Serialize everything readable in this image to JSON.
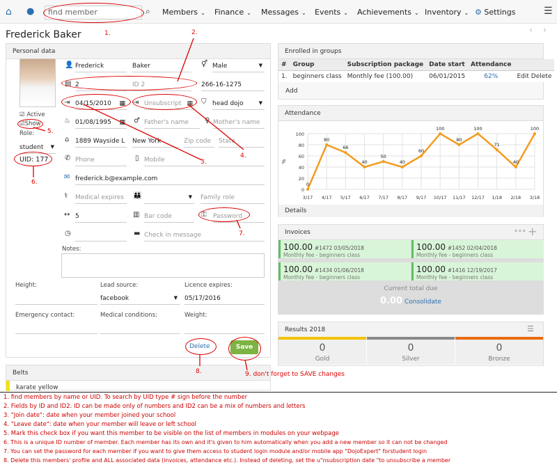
{
  "nav": {
    "search_placeholder": "find member",
    "items": [
      "Members",
      "Finance",
      "Messages",
      "Events",
      "Achievements",
      "Inventory"
    ],
    "settings": "Settings"
  },
  "member": {
    "name": "Frederick Baker",
    "first_name": "Frederick",
    "last_name": "Baker",
    "gender": "Male",
    "id": "2",
    "id2_placeholder": "ID 2",
    "ssn": "266-16-1275",
    "join_date": "04/15/2010",
    "leave_placeholder": "Unsubscript",
    "rank": "head dojo",
    "birth_date": "01/08/1995",
    "fathers_name_ph": "Father's name",
    "mothers_name_ph": "Mother's name",
    "address": "1889 Wayside L",
    "city": "New York",
    "zip_ph": "Zip code",
    "state_ph": "State",
    "phone_ph": "Phone",
    "mobile_ph": "Mobile",
    "email": "frederick.b@example.com",
    "medical_ph": "Medical expires",
    "family_role_ph": "Family role",
    "number": "5",
    "barcode_ph": "Bar code",
    "password_ph": "Password",
    "checkin_ph": "Check in message",
    "active_label": "Active",
    "show_label": "Show",
    "role_label": "Role:",
    "role": "student",
    "uid": "UID: 177",
    "notes_label": "Notes:",
    "height_label": "Height:",
    "lead_label": "Lead source:",
    "lead_value": "facebook",
    "licence_label": "Licence expires:",
    "licence_value": "05/17/2016",
    "emergency_label": "Emergency contact:",
    "medcond_label": "Medical conditions:",
    "weight_label": "Weight:",
    "delete_label": "Delete",
    "save_label": "Save"
  },
  "personal_title": "Personal data",
  "belts": {
    "title": "Belts",
    "item": "karate yellow"
  },
  "groups": {
    "title": "Enrolled in groups",
    "headers": [
      "#",
      "Group",
      "Subscription package",
      "Date start",
      "Attendance",
      ""
    ],
    "rows": [
      [
        "1.",
        "beginners class",
        "Monthly fee (100.00)",
        "06/01/2015",
        "62%",
        "Edit Delete"
      ]
    ],
    "add": "Add"
  },
  "attendance": {
    "title": "Attendance",
    "details": "Details"
  },
  "chart_data": {
    "type": "line",
    "title": "",
    "xlabel": "",
    "ylabel": "%",
    "ylim": [
      0,
      100
    ],
    "yticks": [
      0,
      20,
      40,
      60,
      80,
      100
    ],
    "categories": [
      "3/17",
      "4/17",
      "5/17",
      "6/17",
      "7/17",
      "8/17",
      "9/17",
      "10/17",
      "11/17",
      "12/17",
      "1/18",
      "2/18",
      "3/18"
    ],
    "values": [
      0,
      80,
      66,
      40,
      50,
      40,
      60,
      100,
      80,
      100,
      71,
      40,
      100
    ],
    "color": "#f39c1f",
    "grid": true
  },
  "invoices": {
    "title": "Invoices",
    "items": [
      {
        "amount": "100.00",
        "meta": "#1472 03/05/2018",
        "desc": "Monthly fee - beginners class"
      },
      {
        "amount": "100.00",
        "meta": "#1452 02/04/2018",
        "desc": "Monthly fee - beginners class"
      },
      {
        "amount": "100.00",
        "meta": "#1434 01/06/2018",
        "desc": "Monthly fee - beginners class"
      },
      {
        "amount": "100.00",
        "meta": "#1416 12/19/2017",
        "desc": "Monthly fee - beginners class"
      }
    ],
    "due_label": "Current total due",
    "due_value": "0.00",
    "consolidate": "Consolidate"
  },
  "results": {
    "title": "Results 2018",
    "items": [
      {
        "count": "0",
        "name": "Gold",
        "color": "#f2c200"
      },
      {
        "count": "0",
        "name": "Silver",
        "color": "#888888"
      },
      {
        "count": "0",
        "name": "Bronze",
        "color": "#e86a10"
      }
    ]
  },
  "annotations": {
    "marks": [
      "1.",
      "2.",
      "3.",
      "4.",
      "5.",
      "6.",
      "7.",
      "8."
    ],
    "save_note": "9. don't forget to SAVE changes",
    "notes": [
      "1. find members by name or UID. To search by UID type # sign before the number",
      "2. Fields by ID and ID2. ID can be made only of numbers and ID2 can be a mix of numbers and letters",
      "3. \"Join date\": date when your member joined your school",
      "4. \"Leave date\": date when your member will leave or left school",
      "5. Mark this check box if you want this member to be visible on the list of members in modules on your webpage",
      "6. This is a unique ID number of member. Each member has its own and it's given to him automatically when you add a new member so it can not be changed",
      "7. You can set the password for each member if you want to give them access to student login module and/or mobile app \"DojoExpert\" forstudent login",
      "8. Delete this members' profile  and ALL associated data (invoices, attendance etc.). Instead of deleting, set the u\"nsubscription date \"to unsubscribe a member"
    ]
  }
}
